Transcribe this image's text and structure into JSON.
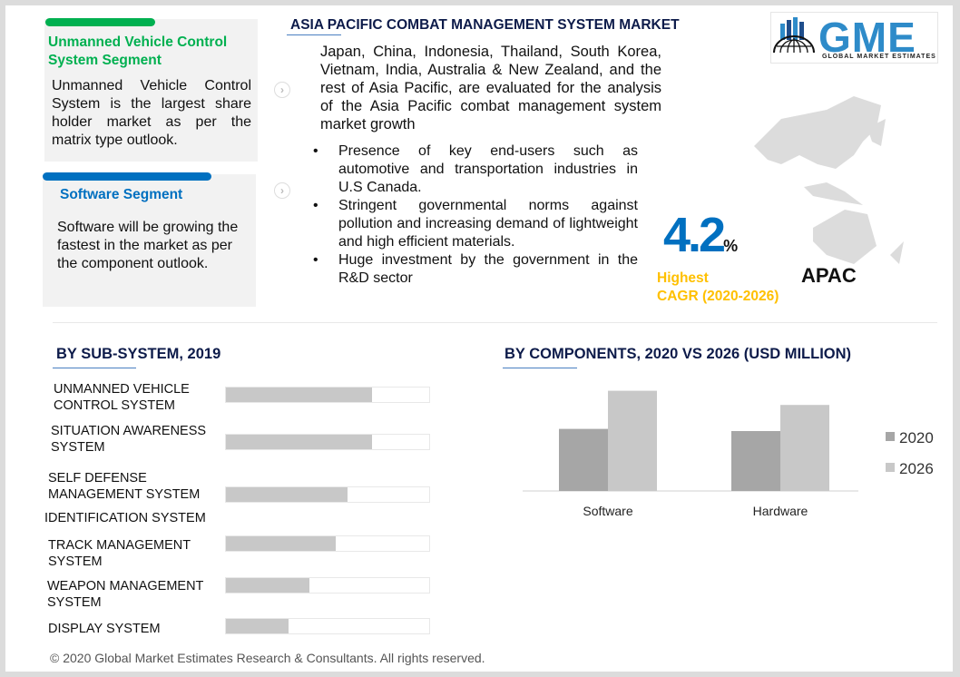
{
  "segments": [
    {
      "title": "Unmanned Vehicle Control System Segment",
      "text": "Unmanned Vehicle Control System is the largest share holder market as per the matrix type outlook.",
      "color": "#00b050"
    },
    {
      "title": "Software Segment",
      "text": "Software will be growing the fastest in the market as per the  component outlook.",
      "color": "#0070c0"
    }
  ],
  "main": {
    "title": "ASIA PACIFIC COMBAT MANAGEMENT SYSTEM MARKET",
    "intro": "Japan, China, Indonesia, Thailand, South Korea, Vietnam, India, Australia & New Zealand, and the rest of Asia Pacific, are evaluated for the analysis of the Asia Pacific combat management system market growth",
    "bullets": [
      "Presence of key end-users such as automotive and transportation industries in U.S Canada.",
      "Stringent governmental norms against pollution and increasing demand of lightweight and high efficient materials.",
      "Huge investment by the government in the R&D sector"
    ]
  },
  "logo": {
    "text": "GME",
    "subtitle": "GLOBAL MARKET ESTIMATES"
  },
  "stat": {
    "value": "4.2",
    "unit": "%",
    "label1": "Highest",
    "label2": "CAGR (2020-2026)",
    "region": "APAC",
    "value_color": "#0070c0",
    "label_color": "#ffc000"
  },
  "chart_data": [
    {
      "type": "bar",
      "orientation": "horizontal",
      "title": "BY SUB-SYSTEM,  2019",
      "categories": [
        "UNMANNED VEHICLE CONTROL SYSTEM",
        "SITUATION AWARENESS SYSTEM",
        "SELF DEFENSE MANAGEMENT SYSTEM",
        "IDENTIFICATION SYSTEM",
        "TRACK MANAGEMENT SYSTEM",
        "WEAPON MANAGEMENT SYSTEM",
        "DISPLAY SYSTEM"
      ],
      "values_fraction": [
        0.72,
        0.72,
        0.6,
        null,
        0.54,
        0.41,
        0.31
      ],
      "color": "#c8c8c8"
    },
    {
      "type": "bar",
      "title": "BY COMPONENTS,  2020 VS 2026 (USD MILLION)",
      "categories": [
        "Software",
        "Hardware"
      ],
      "series": [
        {
          "name": "2020",
          "values": [
            57,
            55
          ],
          "color": "#a6a6a6"
        },
        {
          "name": "2026",
          "values": [
            92,
            79
          ],
          "color": "#c8c8c8"
        }
      ],
      "ylim": [
        0,
        100
      ],
      "grid": false,
      "legend": "right"
    }
  ],
  "footer": "© 2020 Global Market Estimates Research & Consultants. All rights reserved."
}
